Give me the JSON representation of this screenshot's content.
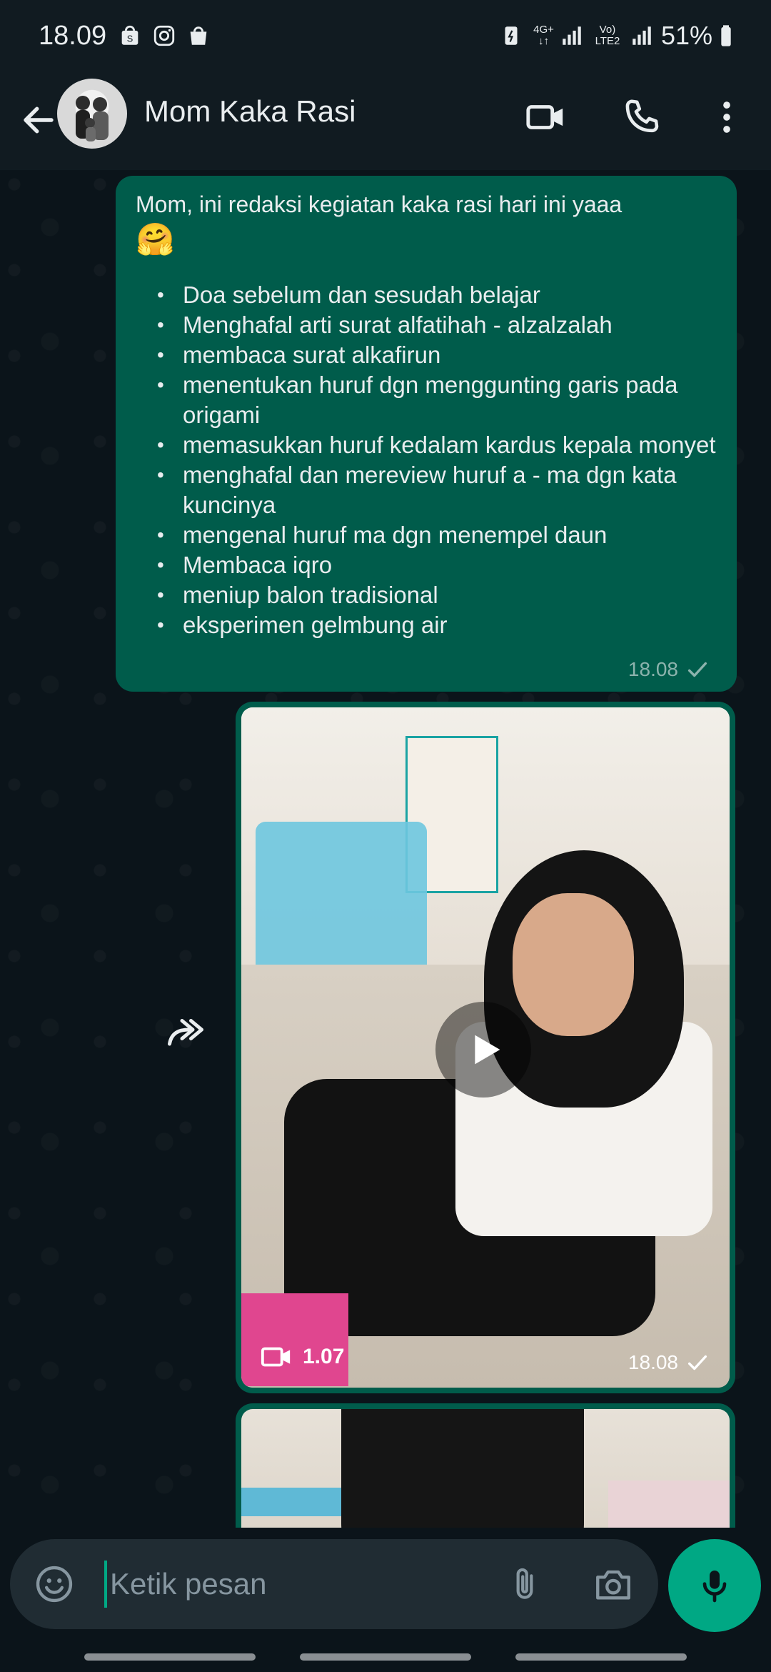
{
  "status_bar": {
    "time": "18.09",
    "network_type": "4G+",
    "volte": "Vo) LTE2",
    "battery": "51%"
  },
  "header": {
    "contact_name": "Mom Kaka Rasi",
    "icons": [
      "back-arrow-icon",
      "video-call-icon",
      "phone-call-icon",
      "more-vert-icon"
    ]
  },
  "messages": {
    "text_message": {
      "intro": "Mom, ini redaksi  kegiatan kaka rasi hari ini yaaa",
      "emoji": "🤗",
      "items": [
        "Doa sebelum dan sesudah belajar",
        "Menghafal arti surat alfatihah - alzalzalah",
        "membaca surat alkafirun",
        "menentukan huruf dgn menggunting garis pada origami",
        "memasukkan huruf kedalam kardus kepala monyet",
        " menghafal dan mereview huruf a - ma dgn kata kuncinya",
        "mengenal huruf ma dgn menempel daun",
        "Membaca iqro",
        "meniup balon tradisional",
        "eksperimen gelmbung air"
      ],
      "time": "18.08"
    },
    "video_message": {
      "duration": "1.07",
      "time": "18.08"
    }
  },
  "composer": {
    "placeholder": "Ketik pesan"
  },
  "colors": {
    "outgoing_bubble": "#005c4b",
    "accent": "#00a884",
    "background": "#0b141a",
    "header": "#111b21"
  }
}
